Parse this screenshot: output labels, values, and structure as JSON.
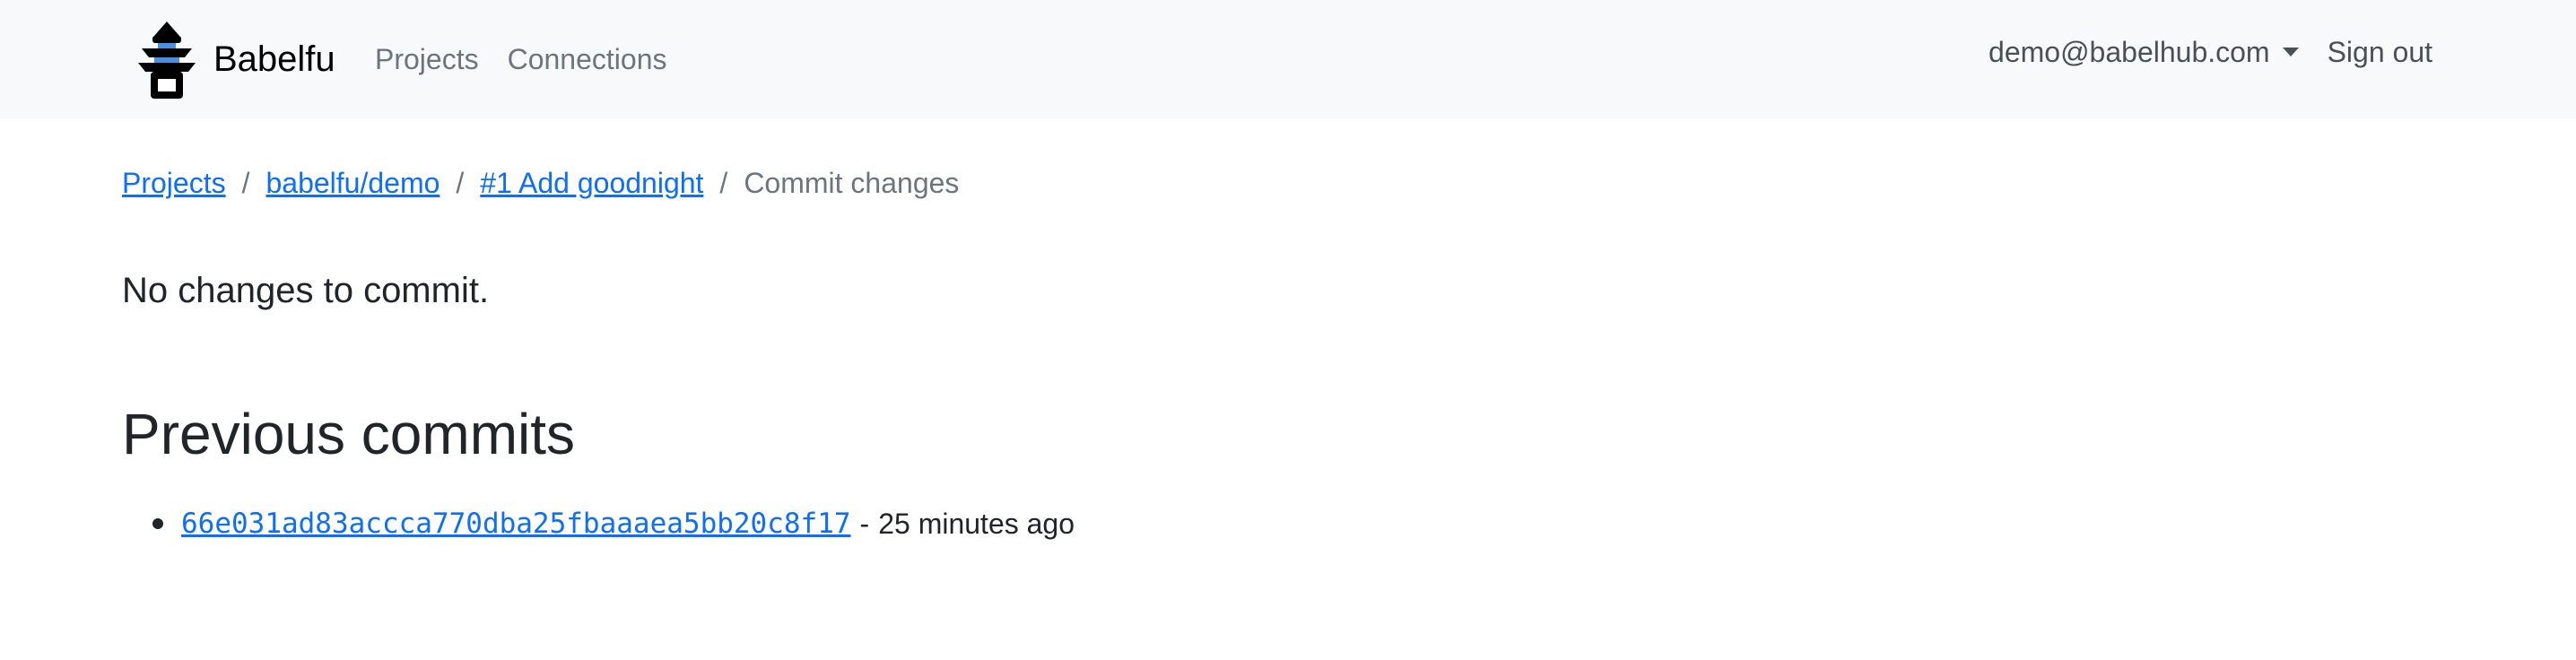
{
  "navbar": {
    "brand": "Babelfu",
    "links": [
      "Projects",
      "Connections"
    ],
    "user": "demo@babelhub.com",
    "sign_out": "Sign out",
    "colors": {
      "background": "#f8f9fa",
      "logo_accent": "#4b8fe2"
    }
  },
  "breadcrumb": {
    "items": [
      "Projects",
      "babelfu/demo",
      "#1 Add goodnight"
    ],
    "separator": "/",
    "current": "Commit changes"
  },
  "main": {
    "message": "No changes to commit.",
    "section_title": "Previous commits",
    "commits": [
      {
        "hash": "66e031ad83accca770dba25fbaaaea5bb20c8f17",
        "separator": "-",
        "time": "25 minutes ago"
      }
    ]
  },
  "colors": {
    "link": "#0d6efd",
    "muted": "#6c757d",
    "text": "#212529"
  }
}
